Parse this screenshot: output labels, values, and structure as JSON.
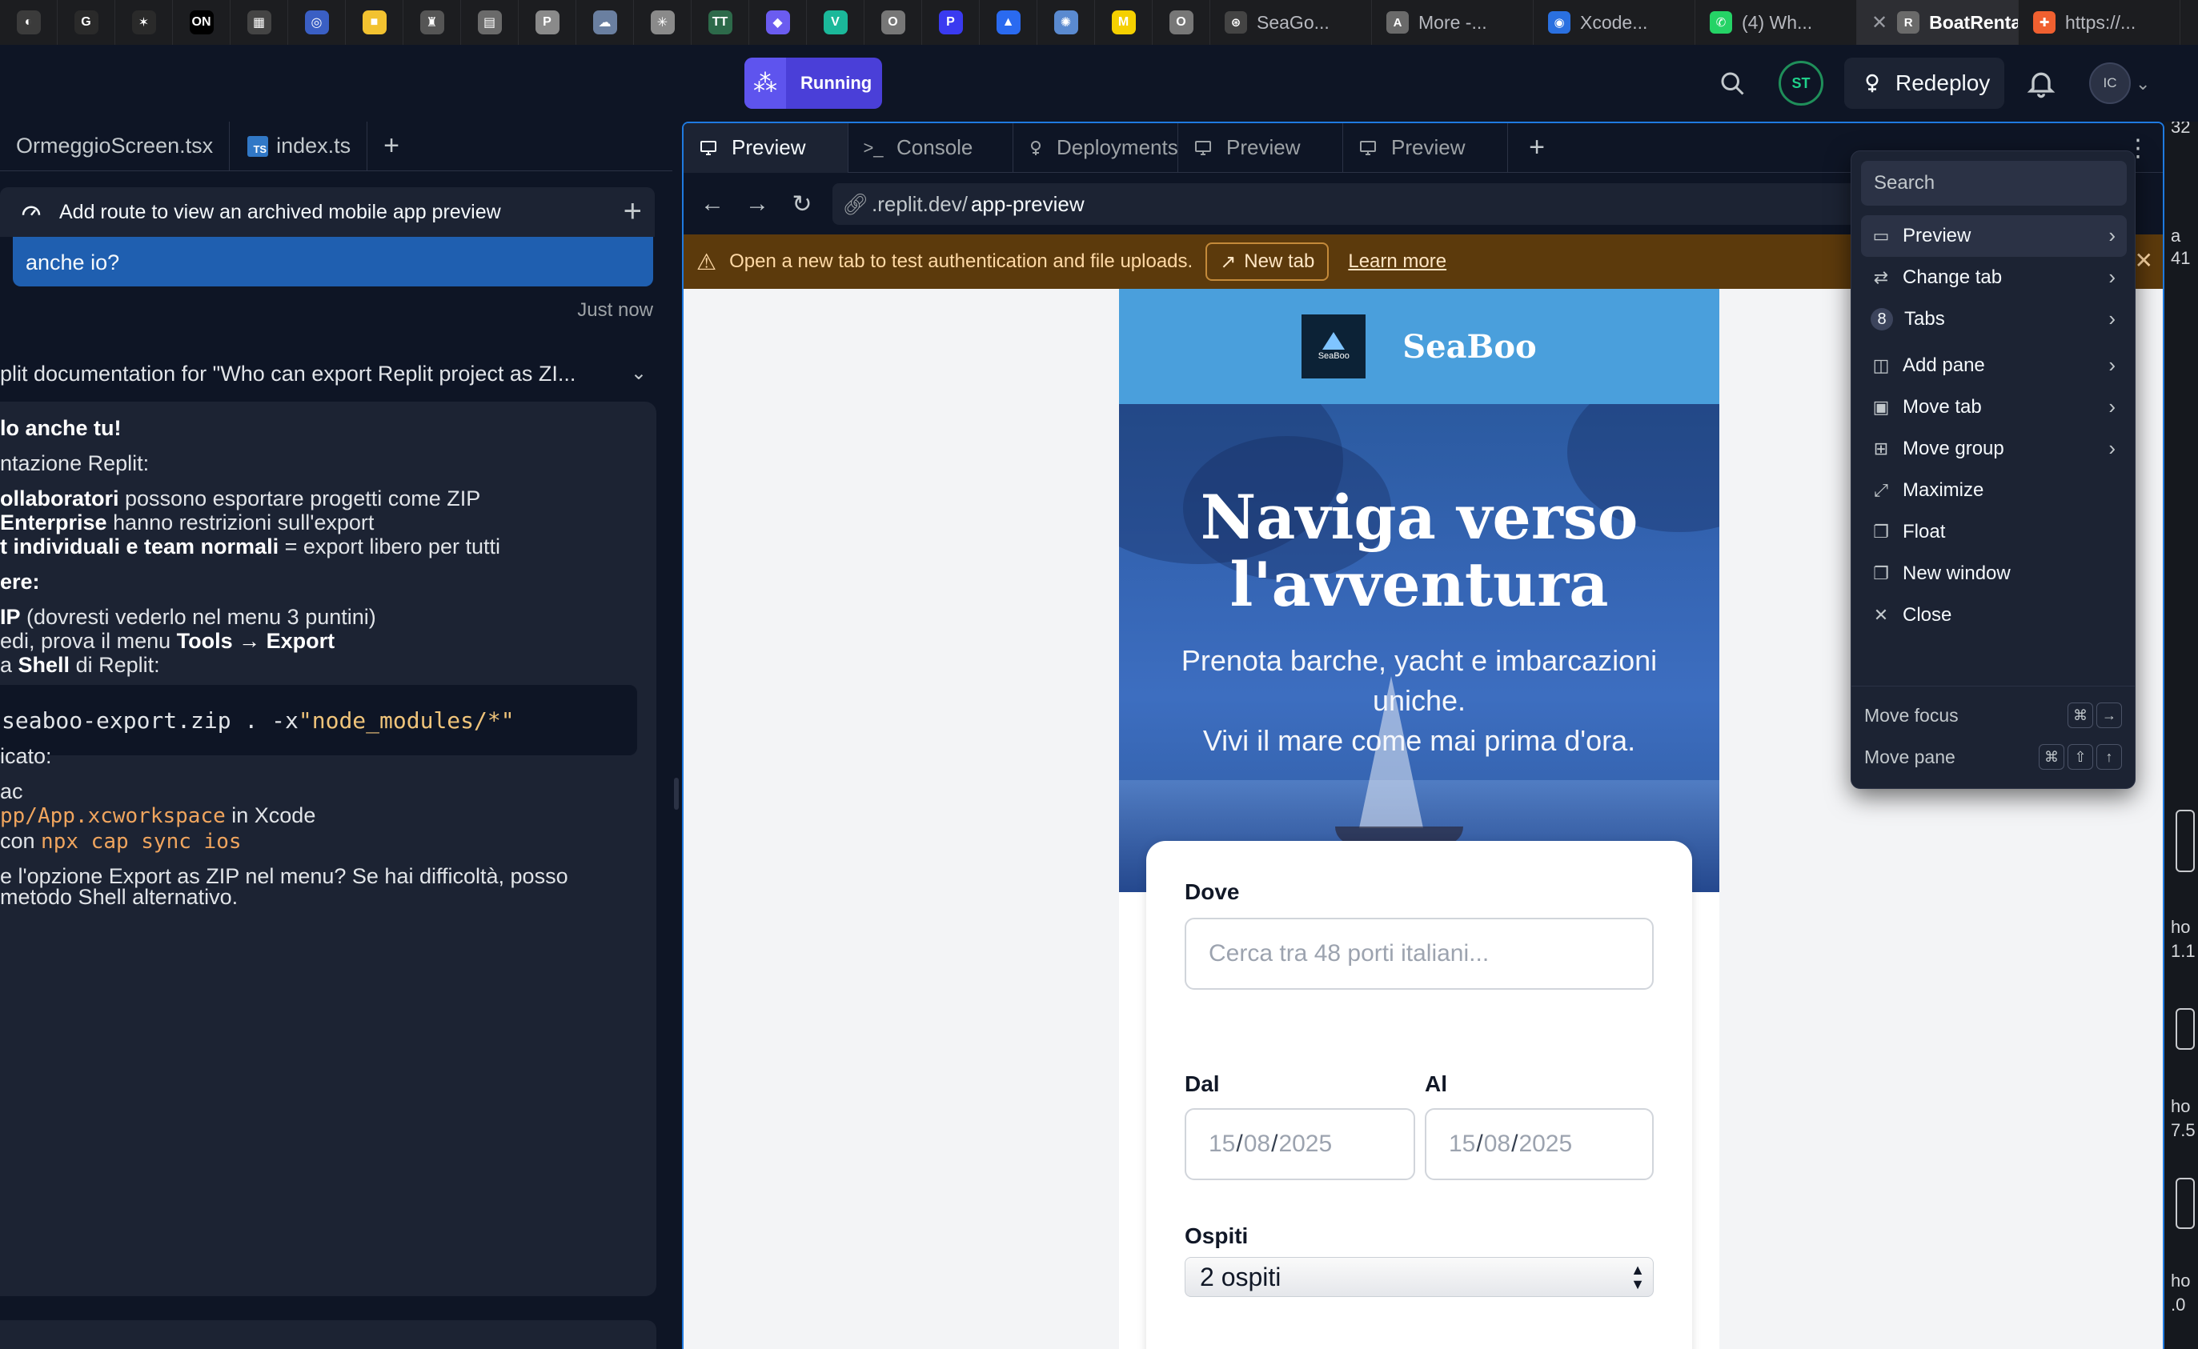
{
  "browser_tabs": {
    "pinned": [
      {
        "icon": "generic-favicon-icon",
        "glyph": "◐",
        "color": "#3b3b3b"
      },
      {
        "icon": "google-favicon-icon",
        "glyph": "G",
        "color": "#2a2a2a"
      },
      {
        "icon": "pinwheel-favicon-icon",
        "glyph": "✶",
        "color": "#2a2a2a"
      },
      {
        "icon": "on-favicon-icon",
        "glyph": "ON",
        "color": "#000000"
      },
      {
        "icon": "calendar-favicon-icon",
        "glyph": "▦",
        "color": "#444444"
      },
      {
        "icon": "circle-favicon-icon",
        "glyph": "◎",
        "color": "#3a5fc4"
      },
      {
        "icon": "folder-favicon-icon",
        "glyph": "■",
        "color": "#f2c230"
      },
      {
        "icon": "figure-favicon-icon",
        "glyph": "♜",
        "color": "#555555"
      },
      {
        "icon": "chart-favicon-icon",
        "glyph": "▤",
        "color": "#6a6a6a"
      },
      {
        "icon": "p-favicon-icon",
        "glyph": "P",
        "color": "#8a8a8a"
      },
      {
        "icon": "cloud-favicon-icon",
        "glyph": "☁",
        "color": "#6a7fa0"
      },
      {
        "icon": "grid-favicon-icon",
        "glyph": "✳",
        "color": "#8a8a8a"
      },
      {
        "icon": "tt-favicon-icon",
        "glyph": "TT",
        "color": "#2d6a4a"
      },
      {
        "icon": "shield-favicon-icon",
        "glyph": "◆",
        "color": "#6b5cf0"
      },
      {
        "icon": "v-favicon-icon",
        "glyph": "V",
        "color": "#1bb89a"
      },
      {
        "icon": "box-favicon-icon",
        "glyph": "O",
        "color": "#777777"
      },
      {
        "icon": "p-circle-favicon-icon",
        "glyph": "P",
        "color": "#3a3af0"
      },
      {
        "icon": "drive-favicon-icon",
        "glyph": "▲",
        "color": "#2a6af0"
      },
      {
        "icon": "globe-favicon-icon",
        "glyph": "✺",
        "color": "#5a8ad0"
      },
      {
        "icon": "m-favicon-icon",
        "glyph": "M",
        "color": "#f5d000"
      },
      {
        "icon": "box2-favicon-icon",
        "glyph": "O",
        "color": "#777777"
      }
    ],
    "tabs": [
      {
        "title": "SeaGo...",
        "icon": "chatgpt-favicon-icon",
        "glyph": "⊛",
        "color": "#444444",
        "active": false
      },
      {
        "title": "More -...",
        "icon": "a-favicon-icon",
        "glyph": "A",
        "color": "#6a6a6a",
        "active": false
      },
      {
        "title": "Xcode...",
        "icon": "xcode-favicon-icon",
        "glyph": "◉",
        "color": "#2a70e0",
        "active": false
      },
      {
        "title": "(4) Wh...",
        "icon": "whatsapp-favicon-icon",
        "glyph": "✆",
        "color": "#25d366",
        "active": false
      },
      {
        "title": "BoatRental...",
        "icon": "replit-r-favicon-icon",
        "glyph": "R",
        "color": "#6a6a6a",
        "active": true
      },
      {
        "title": "https://...",
        "icon": "figma-favicon-icon",
        "glyph": "✚",
        "color": "#f06030",
        "active": false
      }
    ]
  },
  "header": {
    "run_label": "Running",
    "avatar_initials": "ST",
    "redeploy_label": "Redeploy",
    "user_initials": "IC"
  },
  "left": {
    "tabs": [
      {
        "label": "OrmeggioScreen.tsx"
      },
      {
        "label": "index.ts"
      }
    ],
    "checkpoint": "Add route to view an archived mobile app preview",
    "user_message": "anche io?",
    "message_time": "Just now",
    "doc_row": "plit documentation for \"Who can export Replit project as ZI...",
    "ai": {
      "heading": "lo anche tu!",
      "intro": "ntazione Replit:",
      "b1_bold": "ollaboratori",
      "b1_rest": " possono esportare progetti come ZIP",
      "b2_bold": "Enterprise",
      "b2_rest": " hanno restrizioni sull'export",
      "b3_bold": "t individuali e team normali",
      "b3_rest": " = export libero per tutti",
      "how": "ere:",
      "s1_bold": "IP",
      "s1_rest": " (dovresti vederlo nel menu 3 puntini)",
      "s2_pre": "edi, prova il menu ",
      "s2_bold": "Tools → Export",
      "s3_pre": "a ",
      "s3_bold": "Shell",
      "s3_rest": " di Replit:",
      "code_pre": "seaboo-export.zip . -x ",
      "code_str": "\"node_modules/*\"",
      "after": "icato:",
      "m1": "ac",
      "m2_code": "pp/App.xcworkspace",
      "m2_rest": " in Xcode",
      "m3_pre": " con ",
      "m3_code": "npx cap sync ios",
      "closing1": "e l'opzione Export as ZIP nel menu? Se hai difficoltà, posso",
      "closing2": "metodo Shell alternativo."
    }
  },
  "pane": {
    "tabs": [
      {
        "label": "Preview",
        "icon": "monitor-icon",
        "active": true
      },
      {
        "label": "Console",
        "icon": "terminal-icon",
        "active": false
      },
      {
        "label": "Deployments",
        "icon": "deploy-icon",
        "active": false
      },
      {
        "label": "Preview",
        "icon": "monitor-icon",
        "active": false
      },
      {
        "label": "Preview",
        "icon": "monitor-icon",
        "active": false
      }
    ],
    "url_host": ".replit.dev/",
    "url_path": "app-preview",
    "banner": {
      "message": "Open a new tab to test authentication and file uploads.",
      "new_tab": "New tab",
      "learn_more": "Learn more"
    }
  },
  "app": {
    "brand": "SeaBoo",
    "logo_text": "SeaBoo",
    "hero_title_1": "Naviga verso",
    "hero_title_2": "l'avventura",
    "hero_sub_1": "Prenota barche, yacht e imbarcazioni",
    "hero_sub_2": "uniche.",
    "hero_sub_3": "Vivi il mare come mai prima d'ora.",
    "where_label": "Dove",
    "where_placeholder": "Cerca tra 48 porti italiani...",
    "from_label": "Dal",
    "to_label": "Al",
    "date_d": "15",
    "date_m": "08",
    "date_y": "2025",
    "guests_label": "Ospiti",
    "guests_value": "2 ospiti"
  },
  "menu": {
    "search_placeholder": "Search",
    "items": [
      {
        "label": "Preview",
        "icon": "monitor-icon",
        "submenu": true
      },
      {
        "label": "Change tab",
        "icon": "swap-icon",
        "submenu": true
      },
      {
        "label": "Tabs",
        "badge": "8",
        "submenu": true
      },
      {
        "label": "Add pane",
        "icon": "add-pane-icon",
        "submenu": true
      },
      {
        "label": "Move tab",
        "icon": "move-tab-icon",
        "submenu": true
      },
      {
        "label": "Move group",
        "icon": "move-group-icon",
        "submenu": true
      },
      {
        "label": "Maximize",
        "icon": "maximize-icon",
        "submenu": false
      },
      {
        "label": "Float",
        "icon": "float-icon",
        "submenu": false
      },
      {
        "label": "New window",
        "icon": "new-window-icon",
        "submenu": false
      },
      {
        "label": "Close",
        "icon": "close-icon",
        "submenu": false
      }
    ],
    "move_focus": "Move focus",
    "move_pane": "Move pane"
  },
  "right_strip": {
    "t1": "a",
    "t2": "41",
    "t3": "ho",
    "t4": "1.1",
    "t5": "ho",
    "t6": "7.5",
    "t7": "ho",
    "t8": ".0",
    "t9": "32"
  }
}
